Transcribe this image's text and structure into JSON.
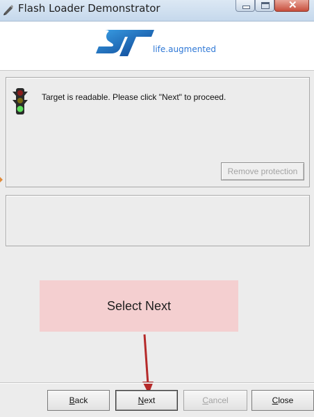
{
  "window": {
    "title": "Flash Loader Demonstrator",
    "controls": {
      "minimize": "minimize",
      "maximize": "maximize",
      "close": "✕"
    }
  },
  "header": {
    "logo_icon": "st-logo-icon",
    "tagline": "life.augmented"
  },
  "status": {
    "icon": "traffic-light-icon",
    "message": "Target is readable. Please click \"Next\" to proceed.",
    "remove_protection_label": "Remove protection"
  },
  "annotation": {
    "text": "Select Next",
    "arrow_icon": "down-arrow-icon",
    "accent_color": "#b52a2a",
    "box_color": "#f4cfd0"
  },
  "buttons": {
    "back": {
      "first": "B",
      "rest": "ack"
    },
    "next": {
      "first": "N",
      "rest": "ext"
    },
    "cancel": {
      "first": "C",
      "rest": "ancel"
    },
    "close": {
      "first": "C",
      "rest": "lose"
    }
  }
}
